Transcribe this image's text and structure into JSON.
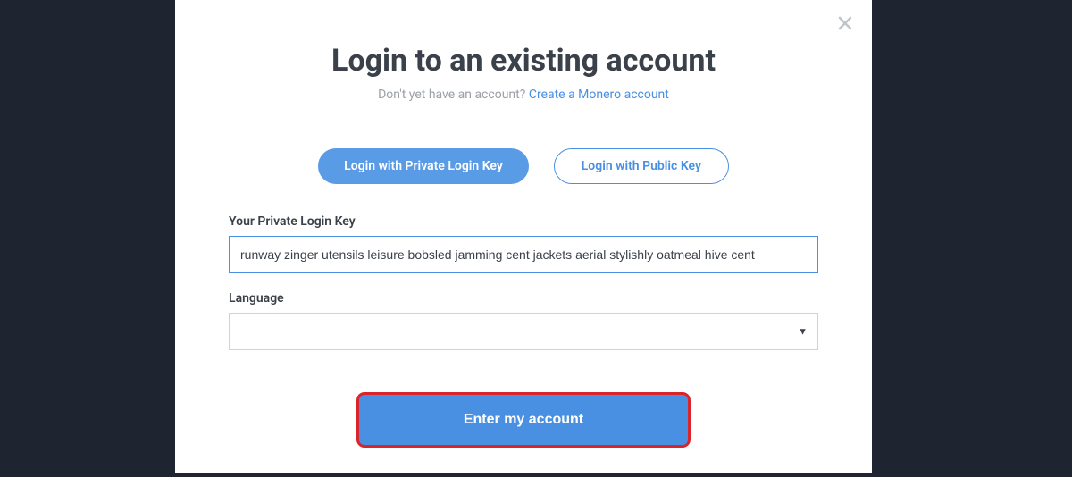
{
  "modal": {
    "title": "Login to an existing account",
    "subtitle_prefix": "Don't yet have an account?  ",
    "create_link": "Create a Monero account"
  },
  "tabs": {
    "private": "Login with Private Login Key",
    "public": "Login with Public Key"
  },
  "form": {
    "private_key_label": "Your Private Login Key",
    "private_key_value": "runway zinger utensils leisure bobsled jamming cent jackets aerial stylishly oatmeal hive cent",
    "language_label": "Language",
    "language_value": ""
  },
  "submit_label": "Enter my account"
}
